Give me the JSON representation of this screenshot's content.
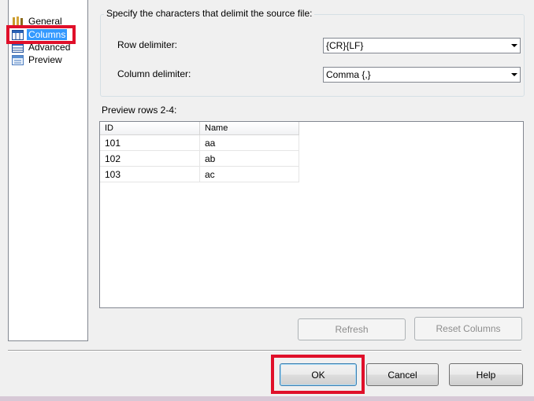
{
  "nav": {
    "items": [
      {
        "label": "General",
        "icon": "wrench-icon"
      },
      {
        "label": "Columns",
        "icon": "columns-icon"
      },
      {
        "label": "Advanced",
        "icon": "table-icon"
      },
      {
        "label": "Preview",
        "icon": "preview-icon"
      }
    ],
    "selected": "Columns"
  },
  "delimiters": {
    "group_title": "Specify the characters that delimit the source file:",
    "row_label": "Row delimiter:",
    "row_value": "{CR}{LF}",
    "column_label": "Column delimiter:",
    "column_value": "Comma {,}"
  },
  "preview": {
    "label": "Preview rows 2-4:",
    "columns": [
      "ID",
      "Name"
    ],
    "rows": [
      [
        "101",
        "aa"
      ],
      [
        "102",
        "ab"
      ],
      [
        "103",
        "ac"
      ]
    ]
  },
  "buttons": {
    "refresh": "Refresh",
    "reset_columns": "Reset Columns",
    "ok": "OK",
    "cancel": "Cancel",
    "help": "Help"
  },
  "colors": {
    "highlight_box": "#e0102a",
    "selection": "#3399ff"
  }
}
